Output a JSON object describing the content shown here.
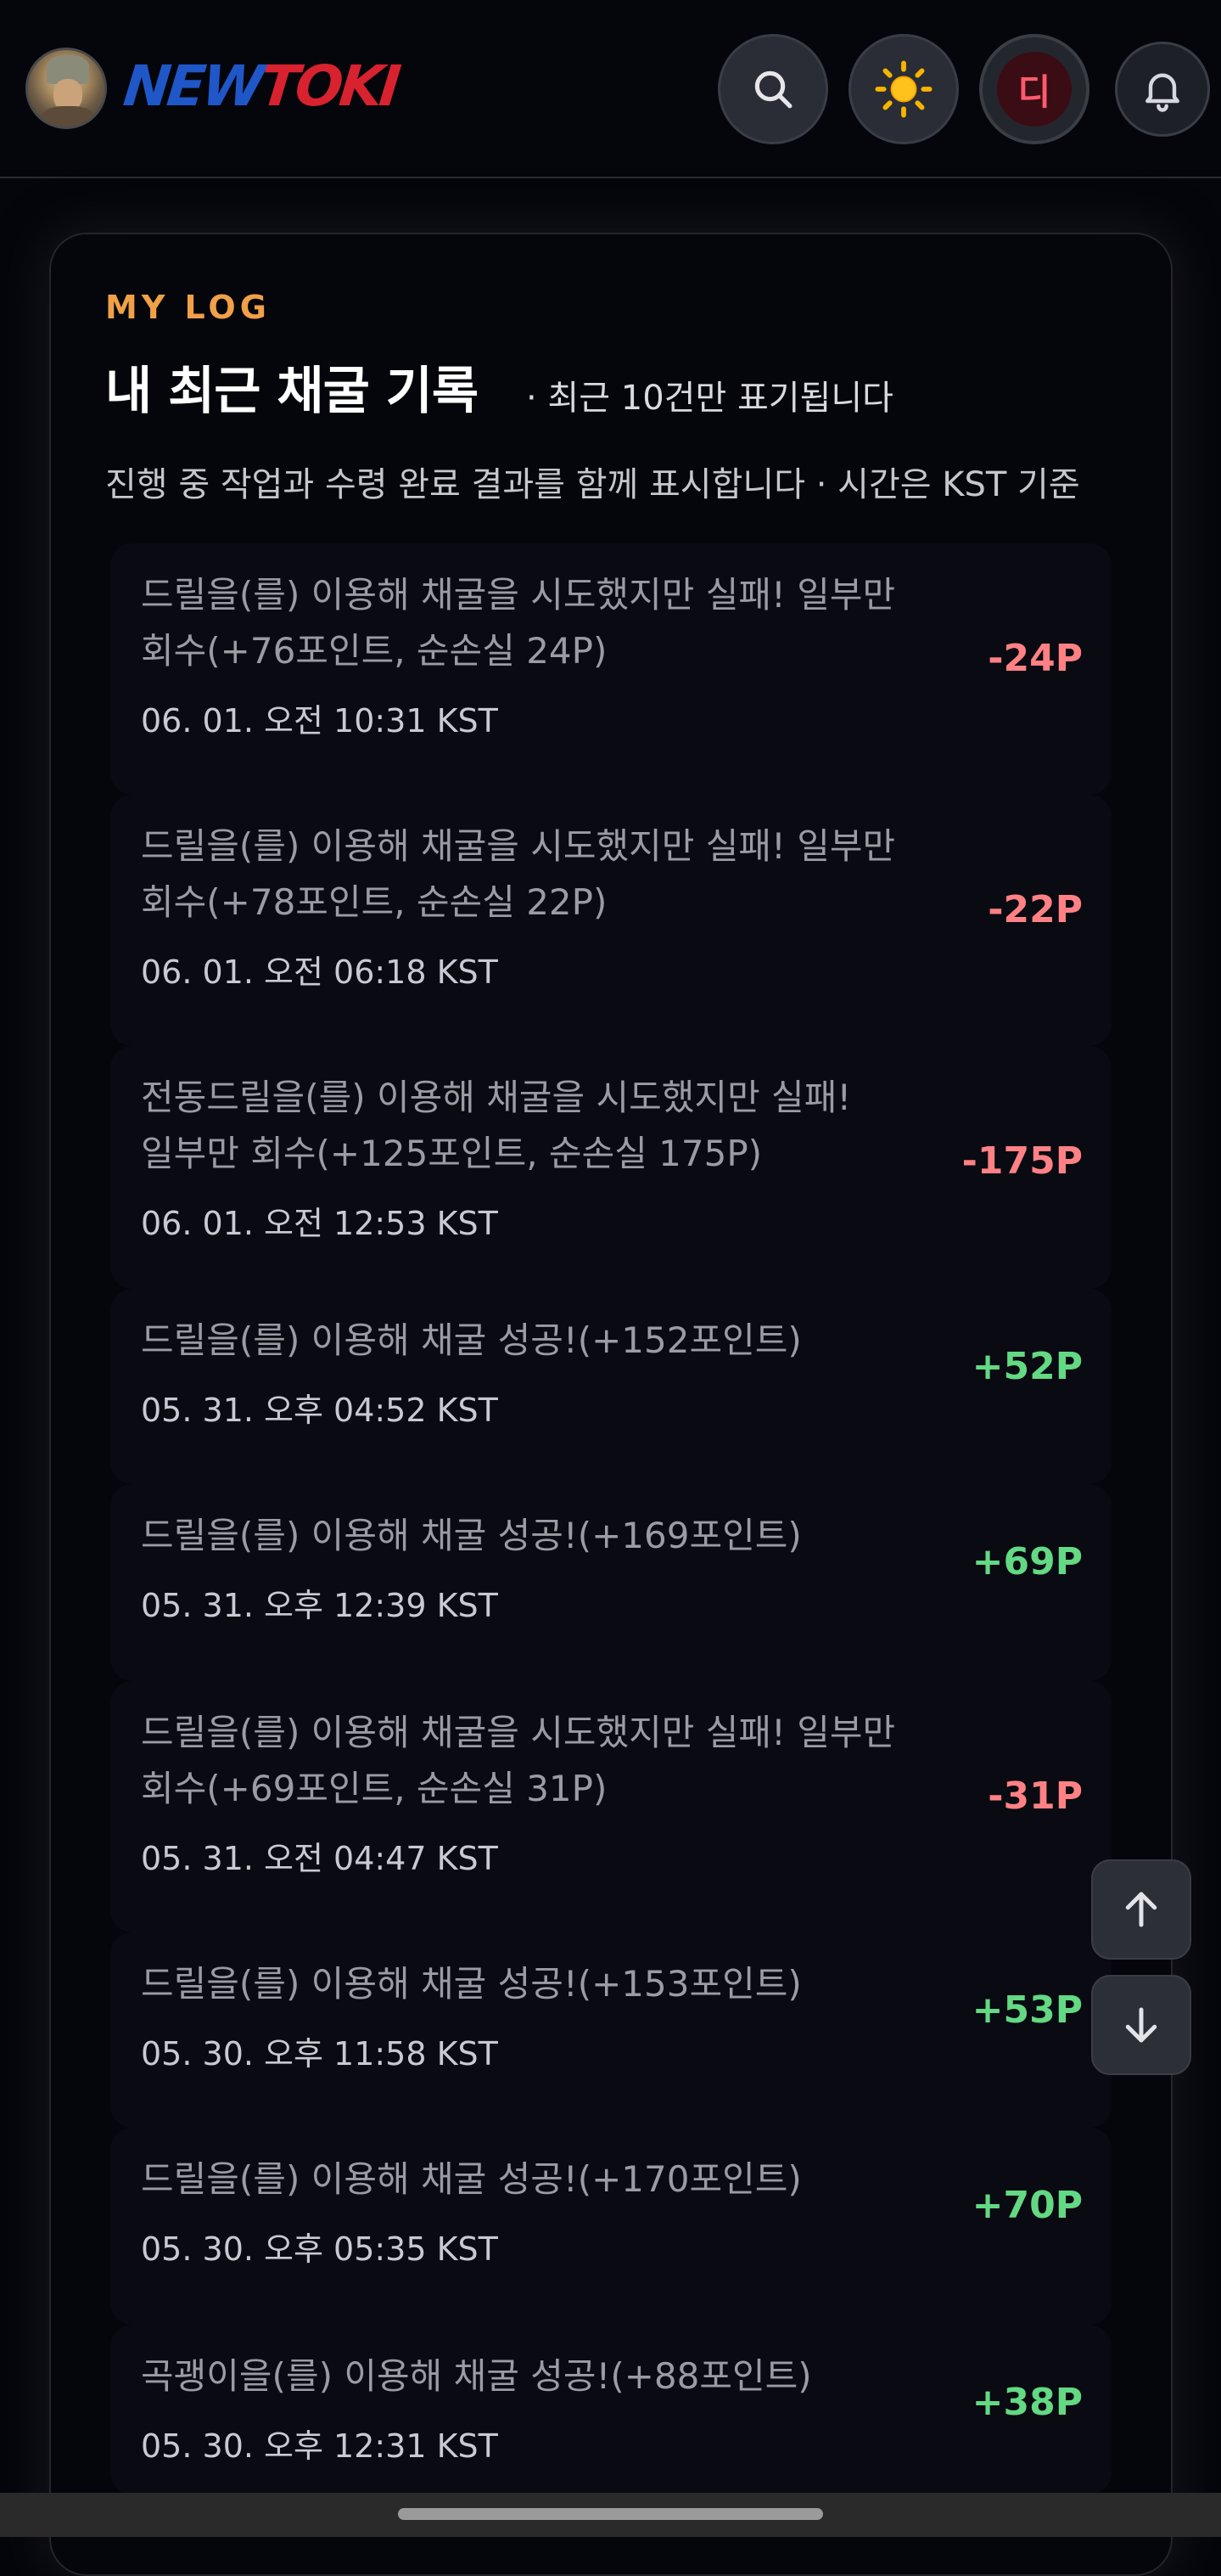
{
  "header": {
    "logo_new": "NEW",
    "logo_toki": "TOKI",
    "avatar_icon": "avatar-portrait",
    "search_icon": "search-icon",
    "theme_icon": "sun-icon",
    "user_initial": "디",
    "bell_icon": "bell-icon"
  },
  "section": {
    "eyebrow": "MY LOG",
    "title": "내 최근 채굴 기록",
    "title_note": "· 최근 10건만 표기됩니다",
    "subtitle": "진행 중 작업과 수령 완료 결과를 함께 표시합니다 · 시간은 KST 기준"
  },
  "logs": [
    {
      "line1": "드릴을(를) 이용해 채굴을 시도했지만 실패! 일부만",
      "line2": "회수(+76포인트, 순손실 24P)",
      "time": "06. 01. 오전 10:31 KST",
      "delta": "-24P",
      "sign": "neg"
    },
    {
      "line1": "드릴을(를) 이용해 채굴을 시도했지만 실패! 일부만",
      "line2": "회수(+78포인트, 순손실 22P)",
      "time": "06. 01. 오전 06:18 KST",
      "delta": "-22P",
      "sign": "neg"
    },
    {
      "line1": "전동드릴을(를) 이용해 채굴을 시도했지만 실패!",
      "line2": "일부만 회수(+125포인트, 순손실 175P)",
      "time": "06. 01. 오전 12:53 KST",
      "delta": "-175P",
      "sign": "neg"
    },
    {
      "line1": "드릴을(를) 이용해 채굴 성공!(+152포인트)",
      "line2": "",
      "time": "05. 31. 오후 04:52 KST",
      "delta": "+52P",
      "sign": "pos"
    },
    {
      "line1": "드릴을(를) 이용해 채굴 성공!(+169포인트)",
      "line2": "",
      "time": "05. 31. 오후 12:39 KST",
      "delta": "+69P",
      "sign": "pos"
    },
    {
      "line1": "드릴을(를) 이용해 채굴을 시도했지만 실패! 일부만",
      "line2": "회수(+69포인트, 순손실 31P)",
      "time": "05. 31. 오전 04:47 KST",
      "delta": "-31P",
      "sign": "neg"
    },
    {
      "line1": "드릴을(를) 이용해 채굴 성공!(+153포인트)",
      "line2": "",
      "time": "05. 30. 오후 11:58 KST",
      "delta": "+53P",
      "sign": "pos"
    },
    {
      "line1": "드릴을(를) 이용해 채굴 성공!(+170포인트)",
      "line2": "",
      "time": "05. 30. 오후 05:35 KST",
      "delta": "+70P",
      "sign": "pos"
    },
    {
      "line1": "곡괭이을(를) 이용해 채굴 성공!(+88포인트)",
      "line2": "",
      "time": "05. 30. 오후 12:31 KST",
      "delta": "+38P",
      "sign": "pos"
    }
  ],
  "controls": {
    "scroll_up_icon": "arrow-up-icon",
    "scroll_down_icon": "arrow-down-icon"
  },
  "colors": {
    "accent": "#f0a046",
    "negative": "#ff8184",
    "positive": "#62d982",
    "logo_blue": "#1f57c9",
    "logo_red": "#d8222f"
  }
}
